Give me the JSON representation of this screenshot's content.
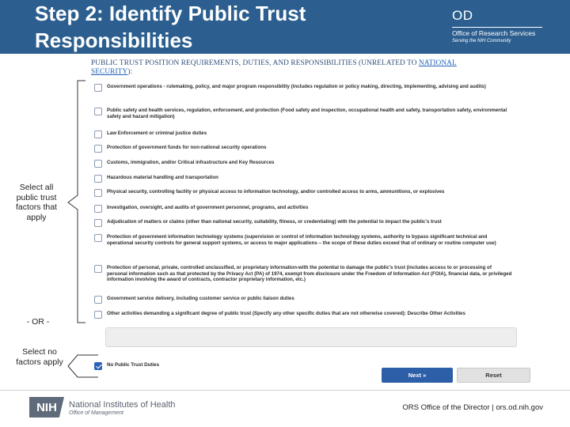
{
  "slide": {
    "title": "Step 2: Identify Public Trust Responsibilities"
  },
  "brand": {
    "od": "OD",
    "office": "Office of Research Services",
    "serving": "Serving the NIH Community"
  },
  "form": {
    "heading_main": "PUBLIC TRUST POSITION REQUIREMENTS, DUTIES, AND RESPONSIBILITIES (UNRELATED TO ",
    "heading_link": "NATIONAL SECURITY",
    "heading_end": "):",
    "options": [
      {
        "text": "Government operations - rulemaking, policy, and major program responsibility (includes regulation or policy making, directing, implementing, advising and audits)",
        "checked": false
      },
      {
        "text": "Public safety and health services, regulation, enforcement, and protection (Food safety and inspection, occupational health and safety, transportation safety, environmental safety and hazard mitigation)",
        "checked": false
      },
      {
        "text": "Law Enforcement or criminal justice duties",
        "checked": false
      },
      {
        "text": "Protection of government funds for non-national security operations",
        "checked": false
      },
      {
        "text": "Customs, immigration, and/or Critical infrastructure and Key Resources",
        "checked": false
      },
      {
        "text": "Hazardous material handling and transportation",
        "checked": false
      },
      {
        "text": "Physical security, controlling facility or physical access to information technology, and/or controlled access to arms, ammunitions, or explosives",
        "checked": false
      },
      {
        "text": "Investigation, oversight, and audits of government personnel, programs, and activities",
        "checked": false
      },
      {
        "text": "Adjudication of matters or claims (other than national security, suitability, fitness, or credentialing) with the potential to impact the public's trust",
        "checked": false
      },
      {
        "text": "Protection of government information technology systems (supervision or control of information technology systems, authority to bypass significant technical and operational security controls for general support systems, or access to major applications – the scope of these duties exceed that of ordinary or routine computer use)",
        "checked": false
      },
      {
        "text": "Protection of personal, private, controlled unclassified, or proprietary information-with the potential to damage the public's trust (includes access to or processing of personal information such as that protected by the Privacy Act (PA) of 1974, exempt from disclosure under the Freedom of Information Act (FOIA), financial data, or privileged information involving the award of contracts, contractor proprietary information, etc.)",
        "checked": false
      },
      {
        "text": "Government service delivery, including customer service or public liaison duties",
        "checked": false
      },
      {
        "text": "Other activities demanding a significant degree of public trust (Specify any other specific duties that are not otherwise covered): Describe Other Activities",
        "checked": false
      },
      {
        "text": "No Public Trust Duties",
        "checked": true
      }
    ],
    "next_label": "Next »",
    "reset_label": "Reset"
  },
  "annotations": {
    "select_all": "Select all public trust factors that apply",
    "or": "- OR -",
    "select_none": "Select no factors apply"
  },
  "footer": {
    "nih_badge": "NIH",
    "nih_name": "National Institutes of Health",
    "nih_sub": "Office of Management",
    "right_text": "ORS Office of the Director | ors.od.nih.gov"
  },
  "colors": {
    "header_bg": "#2c5f8f",
    "accent_blue": "#2d5fa8"
  }
}
